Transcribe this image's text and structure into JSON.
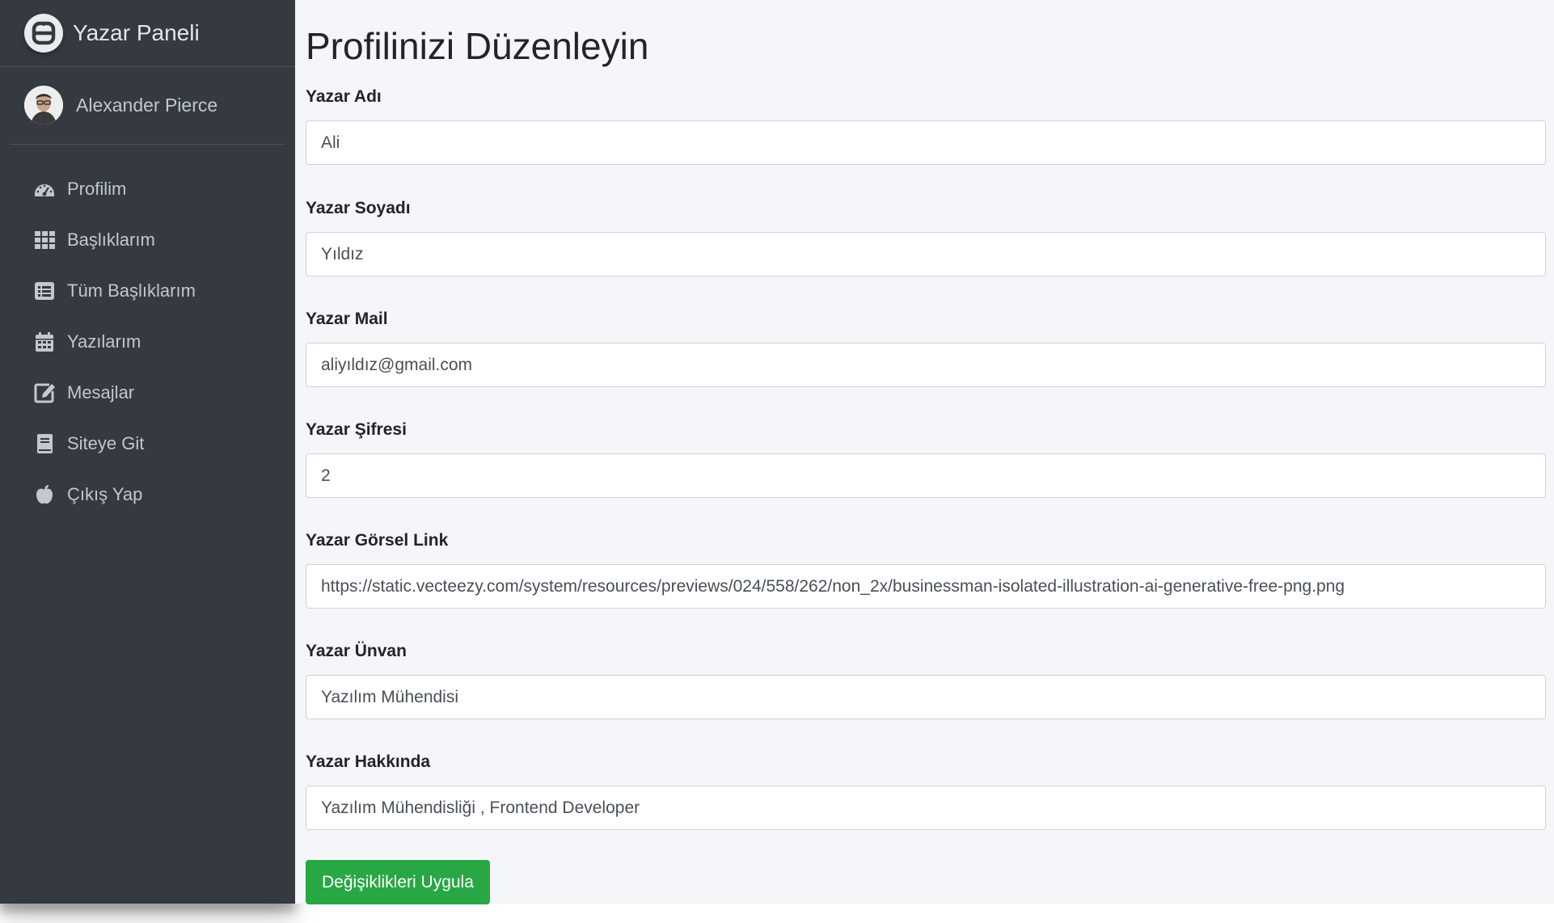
{
  "brand": {
    "title": "Yazar Paneli",
    "logo_icon": "brand-logo-icon"
  },
  "user": {
    "name": "Alexander Pierce",
    "avatar_icon": "user-avatar"
  },
  "sidebar": {
    "items": [
      {
        "label": "Profilim",
        "icon": "tachometer-icon"
      },
      {
        "label": "Başlıklarım",
        "icon": "grid-icon"
      },
      {
        "label": "Tüm Başlıklarım",
        "icon": "list-icon"
      },
      {
        "label": "Yazılarım",
        "icon": "calendar-icon"
      },
      {
        "label": "Mesajlar",
        "icon": "edit-icon"
      },
      {
        "label": "Siteye Git",
        "icon": "book-icon"
      },
      {
        "label": "Çıkış Yap",
        "icon": "apple-icon"
      }
    ]
  },
  "form": {
    "title": "Profilinizi Düzenleyin",
    "fields": [
      {
        "label": "Yazar Adı",
        "value": "Ali"
      },
      {
        "label": "Yazar Soyadı",
        "value": "Yıldız"
      },
      {
        "label": "Yazar Mail",
        "value": "aliyıldız@gmail.com"
      },
      {
        "label": "Yazar Şifresi",
        "value": "2"
      },
      {
        "label": "Yazar Görsel Link",
        "value": "https://static.vecteezy.com/system/resources/previews/024/558/262/non_2x/businessman-isolated-illustration-ai-generative-free-png.png"
      },
      {
        "label": "Yazar Ünvan",
        "value": "Yazılım Mühendisi"
      },
      {
        "label": "Yazar Hakkında",
        "value": "Yazılım Mühendisliği , Frontend Developer"
      }
    ],
    "submit_label": "Değişiklikleri Uygula"
  },
  "colors": {
    "sidebar_bg": "#343a40",
    "content_bg": "#f4f6f9",
    "success": "#28a745",
    "sidebar_text": "#c2c7d0"
  }
}
